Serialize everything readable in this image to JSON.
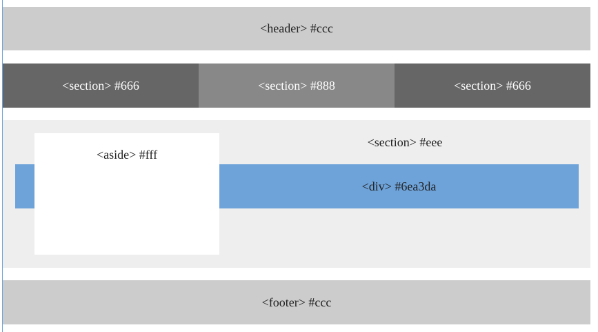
{
  "header": {
    "label": "<header> #ccc",
    "color": "#cccccc"
  },
  "sections": [
    {
      "label": "<section> #666",
      "color": "#666666"
    },
    {
      "label": "<section> #888",
      "color": "#888888"
    },
    {
      "label": "<section> #666",
      "color": "#666666"
    }
  ],
  "main": {
    "label": "<section> #eee",
    "color": "#eeeeee",
    "aside": {
      "label": "<aside> #fff",
      "color": "#ffffff"
    },
    "div": {
      "label": "<div> #6ea3da",
      "color": "#6ea3da"
    }
  },
  "footer": {
    "label": "<footer> #ccc",
    "color": "#cccccc"
  }
}
